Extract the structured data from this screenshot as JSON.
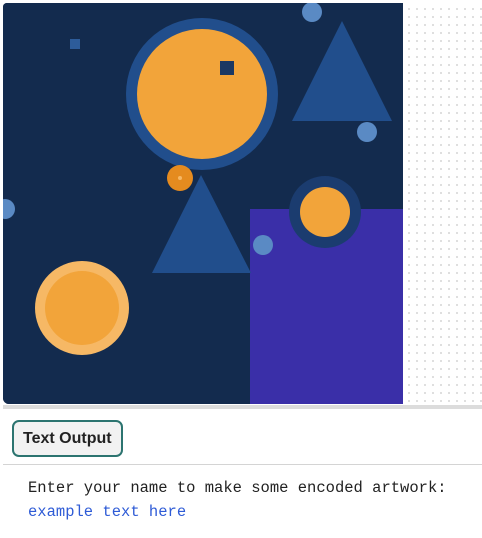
{
  "output_tab": {
    "label": "Text Output"
  },
  "console": {
    "prompt": "Enter your name to make some encoded artwork:",
    "input_value": "example text here"
  },
  "colors": {
    "canvas_background": "#132b4e",
    "orange": "#f2a43a",
    "orange_light": "#f6b865",
    "orange_dark": "#e58b1f",
    "blue": "#214e8c",
    "blue_light": "#5a8ac4",
    "purple": "#3a2fa8",
    "tab_border": "#2c7470",
    "input_text": "#2e5bd6"
  }
}
